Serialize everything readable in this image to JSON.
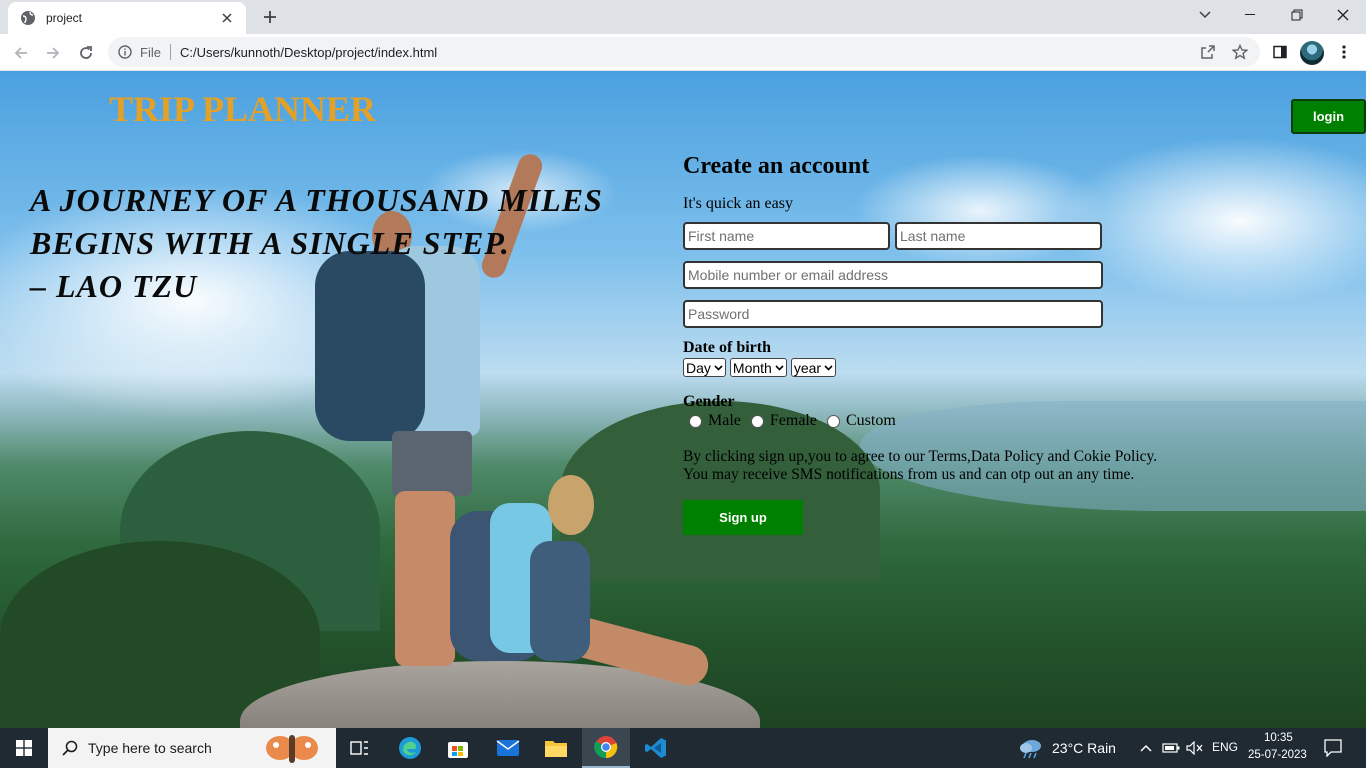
{
  "browser": {
    "tab_title": "project",
    "url_scheme": "File",
    "url": "C:/Users/kunnoth/Desktop/project/index.html"
  },
  "page": {
    "site_title": "TRIP PLANNER",
    "quote_lines": [
      "A JOURNEY OF A THOUSAND MILES",
      "BEGINS WITH A SINGLE STEP.",
      "– LAO TZU"
    ],
    "login_label": "login",
    "form": {
      "heading": "Create an account",
      "subtitle": "It's quick an easy",
      "first_name_placeholder": "First name",
      "last_name_placeholder": "Last name",
      "contact_placeholder": "Mobile number or email address",
      "password_placeholder": "Password",
      "dob_label": "Date of birth",
      "day_value": "Day",
      "month_value": "Month",
      "year_value": "year",
      "gender_label": "Gender",
      "gender_options": [
        "Male",
        "Female",
        "Custom"
      ],
      "terms_line1": "By clicking sign up,you to agree to our Terms,Data Policy and Cokie Policy.",
      "terms_line2": "You may receive SMS notifications from us and can otp out an any time.",
      "signup_label": "Sign up"
    },
    "colors": {
      "title": "#e3a127",
      "button_green": "#008000"
    }
  },
  "taskbar": {
    "search_placeholder": "Type here to search",
    "weather": "23°C  Rain",
    "language": "ENG",
    "time": "10:35",
    "date": "25-07-2023",
    "apps": [
      "task-view-icon",
      "edge-icon",
      "store-icon",
      "mail-icon",
      "file-explorer-icon",
      "chrome-icon",
      "vscode-icon"
    ]
  }
}
